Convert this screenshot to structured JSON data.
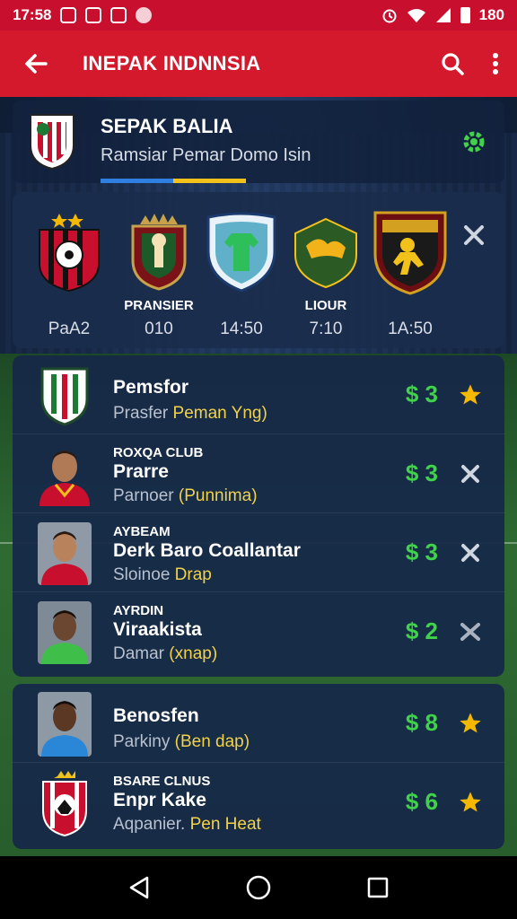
{
  "status_bar": {
    "time": "17:58",
    "right_text": "180",
    "icons": [
      "notification-icon",
      "notification-icon",
      "notification-icon",
      "notification-icon",
      "alarm-icon",
      "wifi-icon",
      "signal-icon",
      "battery-icon"
    ]
  },
  "app_bar": {
    "title": "INEPAK INDNNSIA",
    "back_icon": "arrow-left-icon",
    "search_icon": "search-icon",
    "more_icon": "more-vert-icon"
  },
  "league": {
    "name": "SEPAK BALIA",
    "subtitle": "Ramsiar Pemar Domo Isin",
    "colors": {
      "bar_left": "#2f7fe0",
      "bar_right": "#f2c21a",
      "gear": "#3fd24a"
    }
  },
  "fixtures": [
    {
      "label": "",
      "time": "PaA2"
    },
    {
      "label": "PRANSIER",
      "time": "010"
    },
    {
      "label": "",
      "time": "14:50"
    },
    {
      "label": "LIOUR",
      "time": "7:10"
    },
    {
      "label": "",
      "time": "1A:50"
    }
  ],
  "rows": [
    {
      "kicker": "",
      "name": "Pemsfor",
      "sub_plain": "Prasfer ",
      "sub_hl": "Peman Yng)",
      "price": "$ 3",
      "action": "star"
    },
    {
      "kicker": "ROXQA CLUB",
      "name": "Prarre",
      "sub_plain": "Parnoer ",
      "sub_hl": "(Punnima)",
      "price": "$ 3",
      "action": "close"
    },
    {
      "kicker": "AYBEAM",
      "name": "Derk Baro Coallantar",
      "sub_plain": "Sloinoe ",
      "sub_hl": "Drap",
      "price": "$ 3",
      "action": "close"
    },
    {
      "kicker": "AYRDIN",
      "name": "Viraakista",
      "sub_plain": "Damar ",
      "sub_hl": "(xnap)",
      "price": "$ 2",
      "action": "check"
    }
  ],
  "rows2": [
    {
      "kicker": "",
      "name": "Benosfen",
      "sub_plain": "Parkiny ",
      "sub_hl": "(Ben dap)",
      "price": "$ 8",
      "action": "star"
    },
    {
      "kicker": "BSARE CLNUS",
      "name": "Enpr Kake",
      "sub_plain": "Aqpanier. ",
      "sub_hl": "Pen Heat",
      "price": "$ 6",
      "action": "star"
    }
  ],
  "colors": {
    "accent": "#d4192c",
    "price": "#3fd24a",
    "star": "#f5b800",
    "highlight": "#f2d24a"
  }
}
